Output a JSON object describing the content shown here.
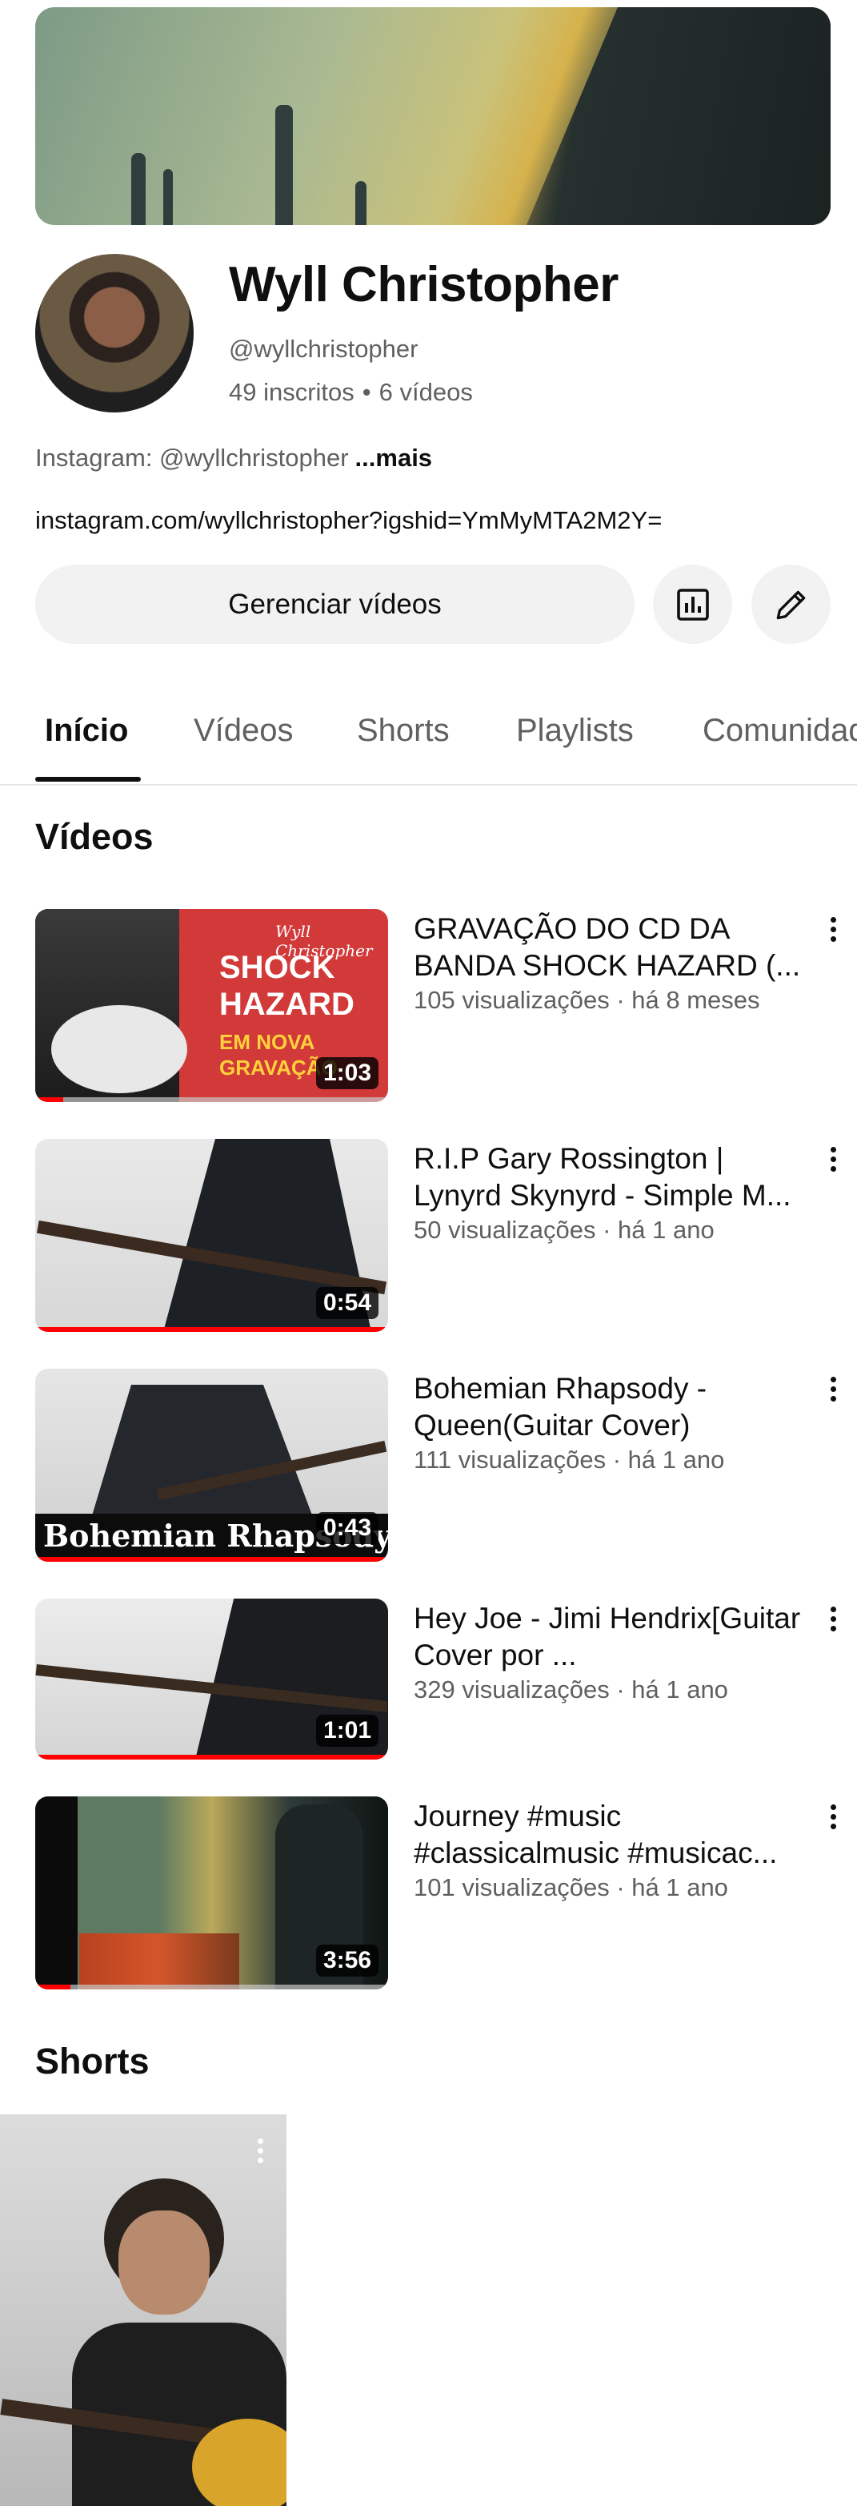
{
  "channel": {
    "name": "Wyll Christopher",
    "handle": "@wyllchristopher",
    "subscribers": "49 inscritos",
    "separator": "•",
    "video_count": "6 vídeos",
    "description": "Instagram: @wyllchristopher",
    "more_label": "...mais",
    "link": "instagram.com/wyllchristopher?igshid=YmMyMTA2M2Y="
  },
  "actions": {
    "manage_label": "Gerenciar vídeos",
    "analytics_icon": "analytics-icon",
    "edit_icon": "pencil-icon"
  },
  "tabs": [
    {
      "label": "Início",
      "active": true
    },
    {
      "label": "Vídeos",
      "active": false
    },
    {
      "label": "Shorts",
      "active": false
    },
    {
      "label": "Playlists",
      "active": false
    },
    {
      "label": "Comunidade",
      "active": false
    }
  ],
  "videos_section": {
    "title": "Vídeos",
    "items": [
      {
        "title": "GRAVAÇÃO DO CD DA BANDA SHOCK HAZARD (...",
        "meta": "105 visualizações · há 8 meses",
        "duration": "1:03",
        "watched": 0.08,
        "thumb_text": {
          "brand": "Wyll Christopher",
          "line1": "SHOCK",
          "line2": "HAZARD",
          "line3": "EM NOVA",
          "line4": "GRAVAÇÃO"
        }
      },
      {
        "title": "R.I.P Gary Rossington | Lynyrd Skynyrd - Simple M...",
        "meta": "50 visualizações · há 1 ano",
        "duration": "0:54",
        "watched": 1.0
      },
      {
        "title": "Bohemian Rhapsody - Queen(Guitar Cover)",
        "meta": "111 visualizações · há 1 ano",
        "duration": "0:43",
        "watched": 1.0,
        "thumb_text": {
          "caption": "Bohemian Rhapsody"
        }
      },
      {
        "title": "Hey Joe - Jimi Hendrix[Guitar Cover por ...",
        "meta": "329 visualizações · há 1 ano",
        "duration": "1:01",
        "watched": 1.0
      },
      {
        "title": "Journey  #music #classicalmusic #musicac...",
        "meta": "101 visualizações · há 1 ano",
        "duration": "3:56",
        "watched": 0.1
      }
    ]
  },
  "shorts_section": {
    "title": "Shorts"
  },
  "colors": {
    "accent": "#ff0000",
    "text_primary": "#0f0f0f",
    "text_secondary": "#606060",
    "button_bg": "#f2f2f2"
  }
}
